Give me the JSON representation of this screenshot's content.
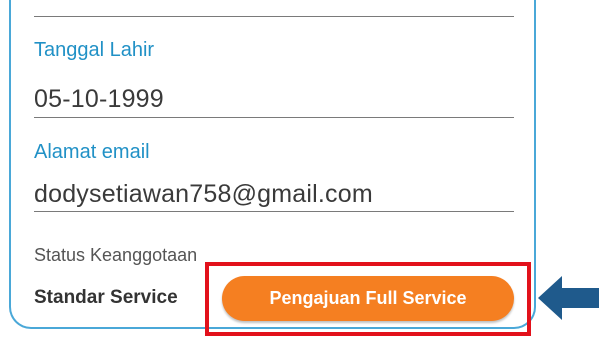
{
  "form": {
    "birth_date_label": "Tanggal Lahir",
    "birth_date_value": "05-10-1999",
    "email_label": "Alamat email",
    "email_value": "dodysetiawan758@gmail.com",
    "membership_label": "Status Keanggotaan",
    "membership_value": "Standar Service",
    "full_service_button": "Pengajuan Full Service"
  },
  "icons": {
    "pointer_arrow": "arrow-left-icon"
  },
  "colors": {
    "label_blue": "#2191c6",
    "button_orange": "#f57f21",
    "highlight_red": "#e2111b",
    "arrow_blue": "#1f5a8c",
    "card_border": "#4aa8d8"
  }
}
